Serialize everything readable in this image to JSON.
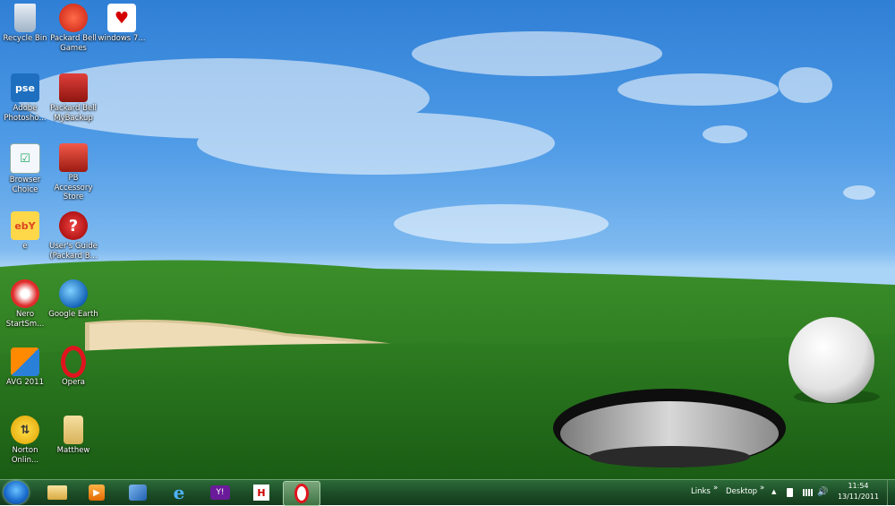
{
  "desktop": {
    "icons": [
      {
        "label": "Recycle Bin",
        "icon": "recycle-bin-icon"
      },
      {
        "label": "Packard Bell Games",
        "icon": "games-icon"
      },
      {
        "label": "windows 7...",
        "icon": "heart-icon"
      },
      {
        "label": "Adobe Photosho...",
        "icon": "photoshop-icon"
      },
      {
        "label": "Packard Bell MyBackup",
        "icon": "backup-icon"
      },
      {
        "label": "Browser Choice",
        "icon": "browser-choice-icon"
      },
      {
        "label": "PB Accessory Store",
        "icon": "store-icon"
      },
      {
        "label": "e",
        "icon": "ebay-icon"
      },
      {
        "label": "User's Guide (Packard B...",
        "icon": "help-icon"
      },
      {
        "label": "Nero StartSm...",
        "icon": "nero-icon"
      },
      {
        "label": "Google Earth",
        "icon": "google-earth-icon"
      },
      {
        "label": "AVG 2011",
        "icon": "avg-icon"
      },
      {
        "label": "Opera",
        "icon": "opera-icon"
      },
      {
        "label": "Norton Onlin...",
        "icon": "norton-icon"
      },
      {
        "label": "Matthew",
        "icon": "user-folder-icon"
      }
    ],
    "glyphs": {
      "photoshop": "pse",
      "ebay": "ebY",
      "help": "?",
      "hotmail": "H"
    }
  },
  "taskbar": {
    "links_label": "Links",
    "desktop_label": "Desktop",
    "chevron": "»",
    "tray_arrow": "▲",
    "clock_time": "11:54",
    "clock_date": "13/11/2011",
    "pinned": [
      "explorer-icon",
      "media-player-icon",
      "paint-icon",
      "internet-explorer-icon",
      "yahoo-icon",
      "hotmail-icon",
      "opera-icon"
    ]
  },
  "colors": {
    "sky": "#4f9be6",
    "grass": "#2f7f22",
    "taskbar": "#1d4f27",
    "bunker": "#eddcb6"
  }
}
